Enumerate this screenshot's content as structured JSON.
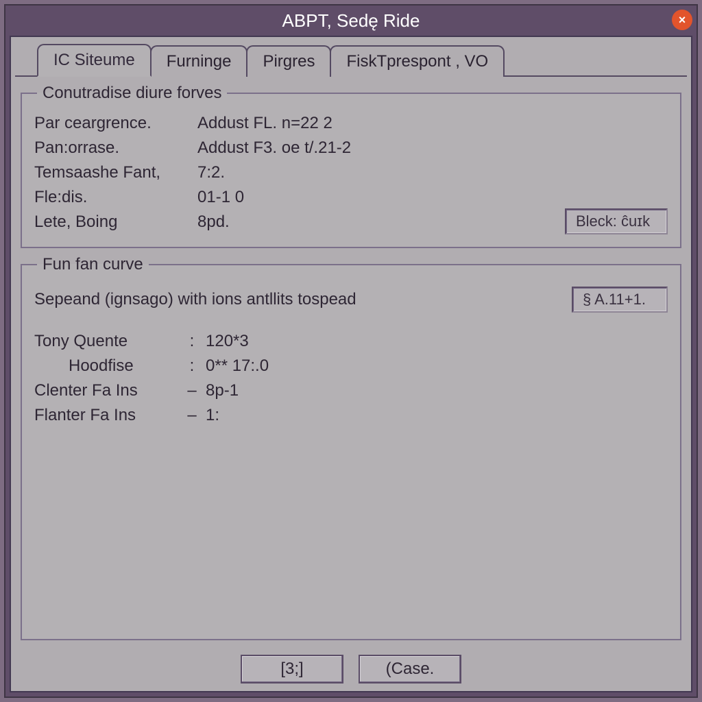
{
  "title": "ABPT, Sedę Ride",
  "close_glyph": "×",
  "tabs": [
    {
      "label": "IC Siteume",
      "active": true
    },
    {
      "label": "Furninge",
      "active": false
    },
    {
      "label": "Pirgres",
      "active": false
    },
    {
      "label": "FiskTprespont , VO",
      "active": false
    }
  ],
  "group1": {
    "legend": "Conutradise diure forves",
    "rows": [
      {
        "label": "Par ceargrence.",
        "value": "Addust FL. n=22 2"
      },
      {
        "label": "Pan:orrase.",
        "value": "Addust F3. oe t/.21-2"
      },
      {
        "label": "Temsaashe Fant,",
        "value": "7:2."
      },
      {
        "label": "Fle:dis.",
        "value": "01-1 0"
      },
      {
        "label": "Lete, Boing",
        "value": "8pd."
      }
    ],
    "button_label": "Bleck: ĉuɪk"
  },
  "group2": {
    "legend": "Fun fan curve",
    "sep_label": "Sepeand (ignsago) with ions antllits tospead",
    "sep_button": "§ A.11+1.",
    "rows": [
      {
        "label": "Tony Quente",
        "sep": ":",
        "value": "120*3"
      },
      {
        "label": "Hoodfise",
        "sep": ":",
        "value": "0** 17:.0",
        "indent": true
      },
      {
        "label": "Clenter Fa Ins",
        "sep": "–",
        "value": "8p-1"
      },
      {
        "label": "Flanter Fa Ins",
        "sep": "–",
        "value": "1:"
      }
    ]
  },
  "buttons": {
    "ok": "[3;]",
    "cancel": "(Case."
  }
}
